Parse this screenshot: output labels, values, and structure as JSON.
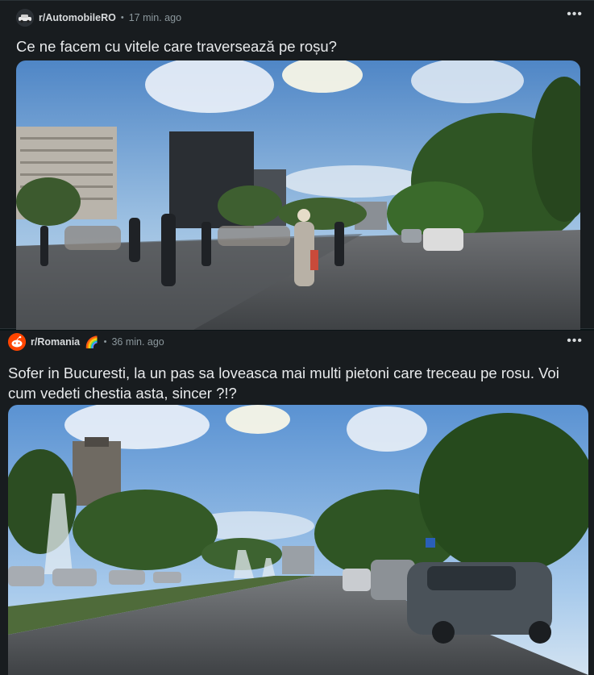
{
  "posts": [
    {
      "subreddit": "r/AutomobileRO",
      "time": "17 min. ago",
      "separator": "•",
      "title": "Ce ne facem cu vitele care traversează pe roșu?",
      "more": "•••",
      "media_icon": "street-pedestrians-photo"
    },
    {
      "subreddit": "r/Romania",
      "flair_icon": "🌈",
      "time": "36 min. ago",
      "separator": "•",
      "title": "Sofer in Bucuresti, la un pas sa loveasca mai multi pietoni care treceau pe rosu. Voi cum vedeti chestia asta, sincer ?!?",
      "more": "•••",
      "media_icon": "boulevard-fountains-photo"
    }
  ],
  "colors": {
    "background": "#0b1416",
    "card": "#181c1f",
    "accent_reddit": "#ff4500"
  }
}
